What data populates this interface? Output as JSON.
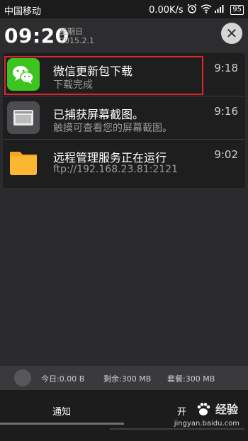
{
  "status_bar": {
    "carrier": "中国移动",
    "speed": "0.00K/s",
    "battery": "95",
    "icons": [
      "alarm-icon",
      "wifi-icon",
      "signal-icon",
      "battery-icon"
    ]
  },
  "header": {
    "time": "09:20",
    "weekday": "星期日",
    "date": "2015.2.1"
  },
  "notifications": [
    {
      "app": "wechat",
      "title": "微信更新包下载",
      "subtitle": "下载完成",
      "time": "9:18"
    },
    {
      "app": "screenshot",
      "title": "已捕获屏幕截图。",
      "subtitle": "触摸可查看您的屏幕截图。",
      "time": "9:16"
    },
    {
      "app": "remote",
      "title": "远程管理服务正在运行",
      "subtitle": "ftp://192.168.23.81:2121",
      "time": "9:02"
    }
  ],
  "traffic": {
    "today": "今日:0.00 B",
    "remaining": "剩余:300 MB",
    "plan": "套餐:300 MB"
  },
  "tabs": {
    "notify": "通知",
    "switch_partial": "开"
  },
  "watermark": {
    "brand": "经验",
    "url": "jingyan.baidu.com"
  },
  "colors": {
    "highlight": "#e0242c",
    "wechat_green": "#3cc51f",
    "folder_orange": "#f5a623"
  }
}
